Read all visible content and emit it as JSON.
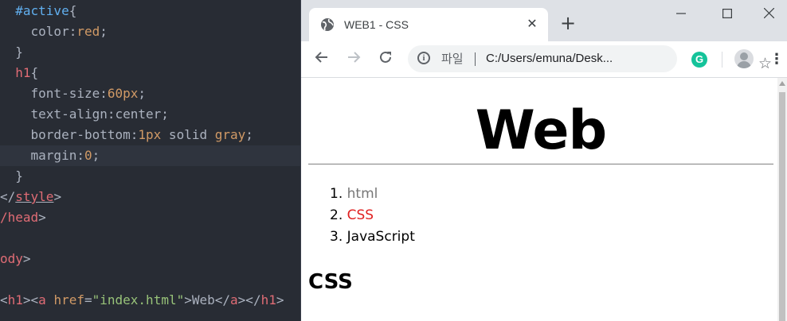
{
  "editor": {
    "lines": [
      {
        "indent": "  ",
        "tokens": [
          {
            "t": "sel",
            "v": "#active"
          },
          {
            "t": "punc",
            "v": "{"
          }
        ]
      },
      {
        "indent": "    ",
        "tokens": [
          {
            "t": "prop",
            "v": "color:"
          },
          {
            "t": "val",
            "v": "red"
          },
          {
            "t": "punc",
            "v": ";"
          }
        ]
      },
      {
        "indent": "  ",
        "tokens": [
          {
            "t": "punc",
            "v": "}"
          }
        ]
      },
      {
        "indent": "  ",
        "tokens": [
          {
            "t": "tag",
            "v": "h1"
          },
          {
            "t": "punc",
            "v": "{"
          }
        ]
      },
      {
        "indent": "    ",
        "tokens": [
          {
            "t": "prop",
            "v": "font-size:"
          },
          {
            "t": "val",
            "v": "60px"
          },
          {
            "t": "punc",
            "v": ";"
          }
        ]
      },
      {
        "indent": "    ",
        "tokens": [
          {
            "t": "prop",
            "v": "text-align:center;"
          }
        ]
      },
      {
        "indent": "    ",
        "tokens": [
          {
            "t": "prop",
            "v": "border-bottom:"
          },
          {
            "t": "val",
            "v": "1px"
          },
          {
            "t": "prop",
            "v": " solid "
          },
          {
            "t": "val",
            "v": "gray"
          },
          {
            "t": "punc",
            "v": ";"
          }
        ]
      },
      {
        "indent": "    ",
        "tokens": [
          {
            "t": "prop",
            "v": "margin:"
          },
          {
            "t": "val",
            "v": "0"
          },
          {
            "t": "punc",
            "v": ";"
          }
        ],
        "highlight": true
      },
      {
        "indent": "  ",
        "tokens": [
          {
            "t": "punc",
            "v": "}"
          }
        ]
      },
      {
        "indent": "",
        "tokens": [
          {
            "t": "punc",
            "v": "</"
          },
          {
            "t": "tag",
            "v": "style",
            "ul": true
          },
          {
            "t": "punc",
            "v": ">"
          }
        ]
      },
      {
        "indent": "",
        "tokens": [
          {
            "t": "tag",
            "v": "/head"
          },
          {
            "t": "punc",
            "v": ">"
          }
        ]
      },
      {
        "indent": "",
        "tokens": []
      },
      {
        "indent": "",
        "tokens": [
          {
            "t": "tag",
            "v": "ody"
          },
          {
            "t": "punc",
            "v": ">"
          }
        ]
      },
      {
        "indent": "",
        "tokens": []
      },
      {
        "indent": "",
        "tokens": [
          {
            "t": "punc",
            "v": "<"
          },
          {
            "t": "tag",
            "v": "h1"
          },
          {
            "t": "punc",
            "v": "><"
          },
          {
            "t": "tag",
            "v": "a"
          },
          {
            "t": "text",
            "v": " "
          },
          {
            "t": "attr",
            "v": "href"
          },
          {
            "t": "punc",
            "v": "="
          },
          {
            "t": "str",
            "v": "\"index.html\""
          },
          {
            "t": "punc",
            "v": ">"
          },
          {
            "t": "text",
            "v": "Web"
          },
          {
            "t": "punc",
            "v": "</"
          },
          {
            "t": "tag",
            "v": "a"
          },
          {
            "t": "punc",
            "v": "></"
          },
          {
            "t": "tag",
            "v": "h1"
          },
          {
            "t": "punc",
            "v": ">"
          }
        ]
      }
    ]
  },
  "browser": {
    "tab": {
      "title": "WEB1 - CSS",
      "icon": "globe-icon",
      "close": "✕"
    },
    "new_tab": "+",
    "window_controls": {
      "minimize": "—",
      "maximize": "☐",
      "close": "✕"
    },
    "nav": {
      "back": "←",
      "forward": "→",
      "reload": "↻"
    },
    "address": {
      "scheme_label": "파일",
      "info_icon": "i",
      "url": "C:/Users/emuna/Desk..."
    },
    "star": "☆",
    "extension": {
      "name": "grammarly-icon",
      "letter": "G",
      "color": "#15c39a"
    },
    "menu": "⋮"
  },
  "page": {
    "heading": "Web",
    "list": [
      {
        "num": "1.",
        "label": "html",
        "color": "#777777"
      },
      {
        "num": "2.",
        "label": "CSS",
        "color": "#e02020"
      },
      {
        "num": "3.",
        "label": "JavaScript",
        "color": "#000000"
      }
    ],
    "subheading": "CSS"
  }
}
